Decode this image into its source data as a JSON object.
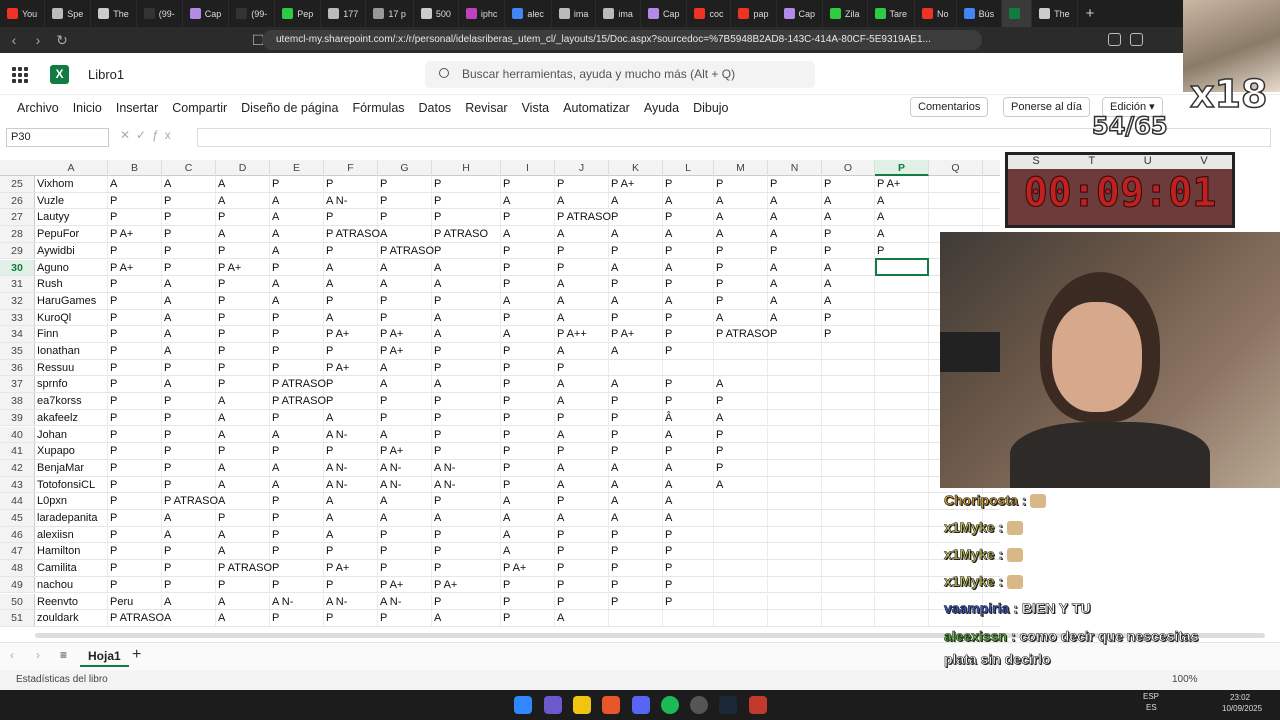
{
  "browser": {
    "tabs": [
      {
        "label": "You",
        "color": "#e32"
      },
      {
        "label": "Spe",
        "color": "#bbb"
      },
      {
        "label": "The",
        "color": "#ccc"
      },
      {
        "label": "(99-",
        "color": "#333"
      },
      {
        "label": "Cap",
        "color": "#b48ae8"
      },
      {
        "label": "(99-",
        "color": "#333"
      },
      {
        "label": "Pep",
        "color": "#2ecc40"
      },
      {
        "label": "177",
        "color": "#bbb"
      },
      {
        "label": "17 p",
        "color": "#999"
      },
      {
        "label": "500",
        "color": "#ccc"
      },
      {
        "label": "iphc",
        "color": "#c040c0"
      },
      {
        "label": "alec",
        "color": "#4285f4"
      },
      {
        "label": "ima",
        "color": "#bbb"
      },
      {
        "label": "ima",
        "color": "#bbb"
      },
      {
        "label": "Cap",
        "color": "#b48ae8"
      },
      {
        "label": "coc",
        "color": "#e32"
      },
      {
        "label": "pap",
        "color": "#e32"
      },
      {
        "label": "Cap",
        "color": "#b48ae8"
      },
      {
        "label": "Zila",
        "color": "#2ecc40"
      },
      {
        "label": "Tare",
        "color": "#2ecc40"
      },
      {
        "label": "No",
        "color": "#e32"
      },
      {
        "label": "Bús",
        "color": "#4285f4"
      },
      {
        "label": "",
        "color": "#107c41"
      },
      {
        "label": "The",
        "color": "#ccc"
      }
    ],
    "url": "utemcl-my.sharepoint.com/:x:/r/personal/idelasriberas_utem_cl/_layouts/15/Doc.aspx?sourcedoc=%7B5948B2AD8-143C-414A-80CF-5E9319AE1..."
  },
  "excel": {
    "book_name": "Libro1",
    "search_placeholder": "Buscar herramientas, ayuda y mucho más (Alt + Q)",
    "menu": [
      "Archivo",
      "Inicio",
      "Insertar",
      "Compartir",
      "Diseño de página",
      "Fórmulas",
      "Datos",
      "Revisar",
      "Vista",
      "Automatizar",
      "Ayuda",
      "Dibujo"
    ],
    "comments": "Comentarios",
    "catch_up": "Ponerse al día",
    "editing": "Edición",
    "name_box": "P30",
    "columns": [
      "A",
      "B",
      "C",
      "D",
      "E",
      "F",
      "G",
      "H",
      "I",
      "J",
      "K",
      "L",
      "M",
      "N",
      "O",
      "P",
      "Q"
    ],
    "rows": [
      {
        "n": "25",
        "cells": [
          "Vixhom",
          "A",
          "A",
          "A",
          "P",
          "P",
          "P",
          "P",
          "P",
          "P",
          "P A+",
          "P",
          "P",
          "P",
          "P",
          "P A+",
          ""
        ]
      },
      {
        "n": "26",
        "cells": [
          "Vuzle",
          "P",
          "P",
          "A",
          "A",
          "A N-",
          "P",
          "P",
          "A",
          "A",
          "A",
          "A",
          "A",
          "A",
          "A",
          "A",
          ""
        ]
      },
      {
        "n": "27",
        "cells": [
          "Lautyy",
          "P",
          "P",
          "P",
          "A",
          "P",
          "P",
          "P",
          "P",
          "P ATRASO",
          "P",
          "P",
          "A",
          "A",
          "A",
          "A",
          ""
        ]
      },
      {
        "n": "28",
        "cells": [
          "PepuFor",
          "P A+",
          "P",
          "A",
          "A",
          "P ATRASO",
          "A",
          "P ATRASO",
          "A",
          "A",
          "A",
          "A",
          "A",
          "A",
          "P",
          "A",
          ""
        ]
      },
      {
        "n": "29",
        "cells": [
          "Aywidbi",
          "P",
          "P",
          "P",
          "A",
          "P",
          "P ATRASO",
          "P",
          "P",
          "P",
          "P",
          "P",
          "P",
          "P",
          "P",
          "P",
          ""
        ]
      },
      {
        "n": "30",
        "cells": [
          "Aguno",
          "P A+",
          "P",
          "P A+",
          "P",
          "A",
          "A",
          "A",
          "P",
          "P",
          "A",
          "A",
          "P",
          "A",
          "A",
          "",
          ""
        ]
      },
      {
        "n": "31",
        "cells": [
          "Rush",
          "P",
          "A",
          "P",
          "A",
          "A",
          "A",
          "A",
          "P",
          "A",
          "P",
          "P",
          "P",
          "A",
          "A",
          "",
          ""
        ]
      },
      {
        "n": "32",
        "cells": [
          "HaruGames",
          "P",
          "A",
          "P",
          "A",
          "P",
          "P",
          "P",
          "A",
          "A",
          "A",
          "A",
          "P",
          "A",
          "A",
          "",
          ""
        ]
      },
      {
        "n": "33",
        "cells": [
          "KuroQl",
          "P",
          "A",
          "P",
          "P",
          "A",
          "P",
          "A",
          "P",
          "A",
          "P",
          "P",
          "A",
          "A",
          "P",
          "",
          ""
        ]
      },
      {
        "n": "34",
        "cells": [
          "Finn",
          "P",
          "A",
          "P",
          "P",
          "P A+",
          "P A+",
          "A",
          "A",
          "P A++",
          "P A+",
          "P",
          "P ATRASO",
          "P",
          "P",
          "",
          ""
        ]
      },
      {
        "n": "35",
        "cells": [
          "Ionathan",
          "P",
          "A",
          "P",
          "P",
          "P",
          "P A+",
          "P",
          "P",
          "A",
          "A",
          "P",
          "",
          "",
          "",
          "",
          ""
        ]
      },
      {
        "n": "36",
        "cells": [
          "Ressuu",
          "P",
          "P",
          "P",
          "P",
          "P A+",
          "A",
          "P",
          "P",
          "P",
          "",
          "",
          "",
          "",
          "",
          "",
          ""
        ]
      },
      {
        "n": "37",
        "cells": [
          "sprnfo",
          "P",
          "A",
          "P",
          "P ATRASO",
          "P",
          "A",
          "A",
          "P",
          "A",
          "A",
          "P",
          "A",
          "",
          "",
          "",
          ""
        ]
      },
      {
        "n": "38",
        "cells": [
          "ea7korss",
          "P",
          "P",
          "A",
          "P ATRASO",
          "P",
          "P",
          "P",
          "P",
          "A",
          "P",
          "P",
          "P",
          "",
          "",
          "",
          ""
        ]
      },
      {
        "n": "39",
        "cells": [
          "akafeelz",
          "P",
          "P",
          "A",
          "P",
          "A",
          "P",
          "P",
          "P",
          "P",
          "P",
          "Â",
          "A",
          "",
          "",
          "",
          ""
        ]
      },
      {
        "n": "40",
        "cells": [
          "Johan",
          "P",
          "P",
          "A",
          "A",
          "A N-",
          "A",
          "P",
          "P",
          "A",
          "P",
          "A",
          "P",
          "",
          "",
          "",
          ""
        ]
      },
      {
        "n": "41",
        "cells": [
          "Xupapo",
          "P",
          "P",
          "P",
          "P",
          "P",
          "P A+",
          "P",
          "P",
          "P",
          "P",
          "P",
          "P",
          "",
          "",
          "",
          ""
        ]
      },
      {
        "n": "42",
        "cells": [
          "BenjaMar",
          "P",
          "P",
          "A",
          "A",
          "A N-",
          "A N-",
          "A N-",
          "P",
          "A",
          "A",
          "A",
          "P",
          "",
          "",
          "",
          ""
        ]
      },
      {
        "n": "43",
        "cells": [
          "TotofonsiCL",
          "P",
          "P",
          "A",
          "A",
          "A N-",
          "A N-",
          "A N-",
          "P",
          "A",
          "A",
          "A",
          "A",
          "",
          "",
          "",
          ""
        ]
      },
      {
        "n": "44",
        "cells": [
          "L0pxn",
          "P",
          "P ATRASO",
          "A",
          "P",
          "A",
          "A",
          "P",
          "A",
          "P",
          "A",
          "A",
          "",
          "",
          "",
          "",
          ""
        ]
      },
      {
        "n": "45",
        "cells": [
          "laradepanita",
          "P",
          "A",
          "P",
          "P",
          "A",
          "A",
          "A",
          "A",
          "A",
          "A",
          "A",
          "",
          "",
          "",
          "",
          ""
        ]
      },
      {
        "n": "46",
        "cells": [
          "alexiisn",
          "P",
          "A",
          "A",
          "P",
          "A",
          "P",
          "P",
          "A",
          "P",
          "P",
          "P",
          "",
          "",
          "",
          "",
          ""
        ]
      },
      {
        "n": "47",
        "cells": [
          "Hamilton",
          "P",
          "P",
          "A",
          "P",
          "P",
          "P",
          "P",
          "A",
          "P",
          "P",
          "P",
          "",
          "",
          "",
          "",
          ""
        ]
      },
      {
        "n": "48",
        "cells": [
          "Camilita",
          "P",
          "P",
          "P ATRASO",
          "P",
          "P A+",
          "P",
          "P",
          "P A+",
          "P",
          "P",
          "P",
          "",
          "",
          "",
          "",
          ""
        ]
      },
      {
        "n": "49",
        "cells": [
          "nachou",
          "P",
          "P",
          "P",
          "P",
          "P",
          "P A+",
          "P A+",
          "P",
          "P",
          "P",
          "P",
          "",
          "",
          "",
          "",
          ""
        ]
      },
      {
        "n": "50",
        "cells": [
          "Reenvto",
          "Peru",
          "A",
          "A",
          "A N-",
          "A N-",
          "A N-",
          "P",
          "P",
          "P",
          "P",
          "P",
          "",
          "",
          "",
          "",
          ""
        ]
      },
      {
        "n": "51",
        "cells": [
          "zouldark",
          "P ATRASO",
          "A",
          "A",
          "P",
          "P",
          "P",
          "A",
          "P",
          "A",
          "",
          "",
          "",
          "",
          "",
          "",
          ""
        ]
      }
    ],
    "sheet_tab": "Hoja1",
    "status": "Estadísticas del libro",
    "zoom": "100%"
  },
  "stream": {
    "counter": "x18",
    "ratio": "54/65",
    "timer": "00:09:01",
    "timer_cols": [
      "S",
      "T",
      "U",
      "V"
    ],
    "chat": [
      {
        "user": "Choriposta",
        "msg": ""
      },
      {
        "user": "x1Myke",
        "msg": ""
      },
      {
        "user": "x1Myke",
        "msg": ""
      },
      {
        "user": "x1Myke",
        "msg": ""
      },
      {
        "user": "vaampiria",
        "msg": "BIEN Y TU"
      },
      {
        "user": "aleexissn",
        "msg": "como decir que nescesitas"
      },
      {
        "user": "",
        "msg": "plata sin decirlo"
      }
    ]
  },
  "taskbar": {
    "lang": "ESP",
    "lang2": "ES",
    "time": "23:02",
    "date": "10/09/2025"
  }
}
